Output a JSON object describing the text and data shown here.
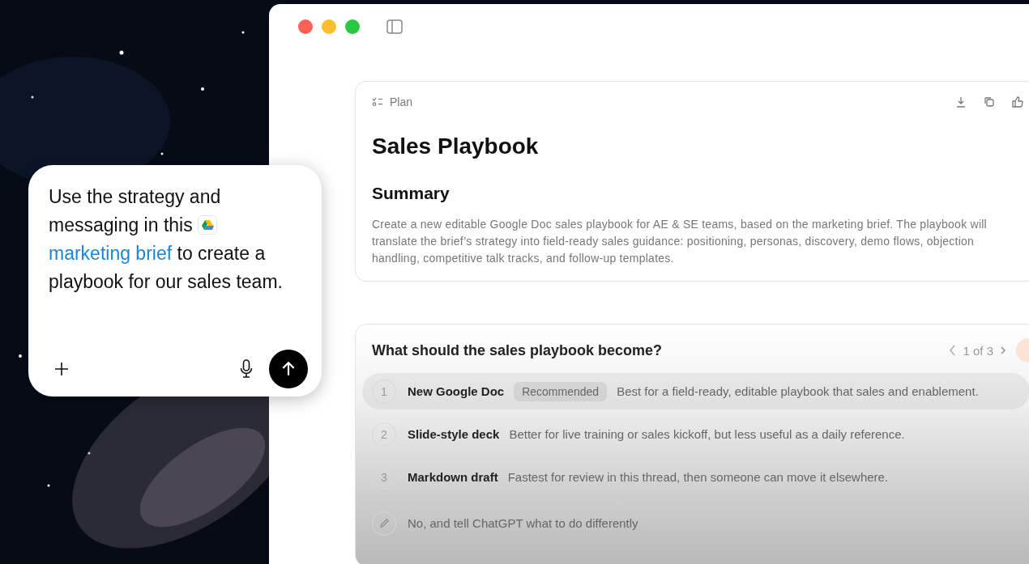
{
  "prompt": {
    "line_before": "Use the strategy and messaging in this",
    "link": "marketing brief",
    "line_after": "to create a playbook for our sales team."
  },
  "plan": {
    "label": "Plan",
    "title": "Sales Playbook",
    "heading": "Summary",
    "summary": "Create a new editable Google Doc sales playbook for AE & SE teams, based on the marketing brief. The playbook will translate the brief’s strategy into field-ready sales guidance: positioning, personas, discovery, demo flows, objection handling, competitive talk tracks, and follow-up templates."
  },
  "question": {
    "title": "What should the sales playbook become?",
    "pager": "1 of 3",
    "options": [
      {
        "number": "1",
        "title": "New Google Doc",
        "tag": "Recommended",
        "detail": "Best for a field-ready, editable playbook that sales and enablement.",
        "selected": true
      },
      {
        "number": "2",
        "title": "Slide-style deck",
        "detail": "Better for live training or sales kickoff, but less useful as a daily reference.",
        "selected": false
      },
      {
        "number": "3",
        "title": "Markdown draft",
        "detail": "Fastest for review in this thread, then someone can move it elsewhere.",
        "selected": false
      }
    ],
    "custom": "No, and tell ChatGPT what to do differently"
  }
}
